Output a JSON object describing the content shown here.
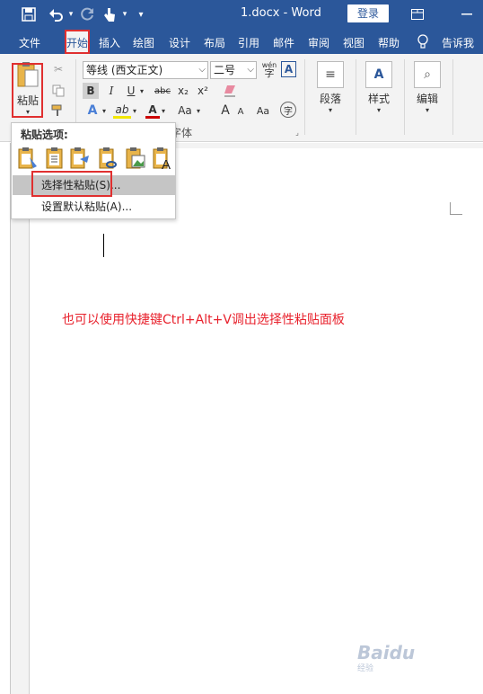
{
  "title_bar": {
    "document": "1.docx  -  Word",
    "login": "登录"
  },
  "tabs": [
    "文件",
    "开始",
    "插入",
    "绘图",
    "设计",
    "布局",
    "引用",
    "邮件",
    "审阅",
    "视图",
    "帮助",
    "告诉我"
  ],
  "ribbon": {
    "paste_label": "粘贴",
    "font_name": "等线 (西文正文)",
    "font_size": "二号",
    "phonetic": "wén",
    "font_group_label": "字体",
    "paragraph_label": "段落",
    "styles_label": "样式",
    "editing_label": "编辑",
    "bold": "B",
    "italic": "I",
    "underline": "U",
    "strike": "abc",
    "subscript": "x₂",
    "superscript": "x²",
    "text_effect": "A",
    "highlight": "ab",
    "font_color": "A",
    "change_case": "Aa",
    "grow": "A",
    "shrink": "A",
    "enclose": "字"
  },
  "paste_popup": {
    "title": "粘贴选项:",
    "items": [
      {
        "label": "选择性粘贴(S)..."
      },
      {
        "label": "设置默认粘贴(A)..."
      }
    ]
  },
  "document": {
    "note": "也可以使用快捷键Ctrl+Alt+V调出选择性粘贴面板"
  },
  "watermark": {
    "brand": "Baidu",
    "sub": "经验"
  },
  "colors": {
    "brand_blue": "#2b579a",
    "highlight_red": "#e03030",
    "note_red": "#e8222d"
  },
  "icons": [
    "save-icon",
    "undo-icon",
    "redo-icon",
    "touch-mode-icon",
    "customize-icon",
    "ribbon-display-icon",
    "minimize-icon",
    "lightbulb-icon",
    "cut-icon",
    "copy-icon",
    "format-painter-icon",
    "clear-format-icon",
    "paragraph-icon",
    "styles-icon",
    "search-icon"
  ]
}
